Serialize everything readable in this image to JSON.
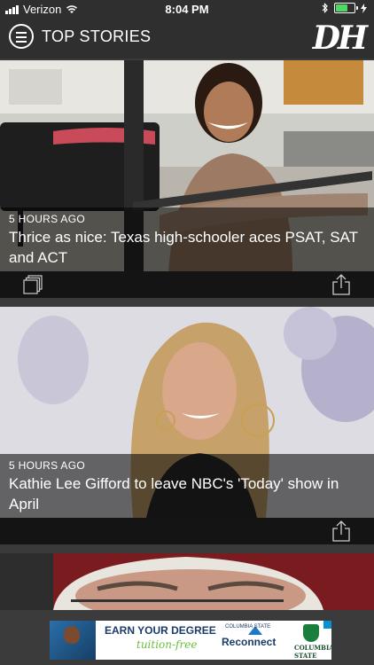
{
  "status_bar": {
    "carrier": "Verizon",
    "time": "8:04 PM"
  },
  "header": {
    "title": "TOP STORIES",
    "logo_text": "DH",
    "menu_icon": "hamburger-menu-icon"
  },
  "stories": [
    {
      "time_ago": "5 HOURS AGO",
      "headline": "Thrice as nice: Texas high-schooler aces PSAT, SAT and ACT",
      "gallery_icon": "gallery-icon",
      "share_icon": "share-icon"
    },
    {
      "time_ago": "5 HOURS AGO",
      "headline": "Kathie Lee Gifford to leave NBC's 'Today' show in April",
      "share_icon": "share-icon"
    }
  ],
  "ad": {
    "headline": "EARN YOUR DEGREE",
    "tagline": "tuition-free",
    "school_small": "COLUMBIA STATE",
    "program": "Reconnect",
    "brand": "COLUMBIA STATE"
  },
  "colors": {
    "header_bg": "#2f2f2f",
    "battery_green": "#4cd964",
    "page_bg": "#3a3a3a"
  }
}
